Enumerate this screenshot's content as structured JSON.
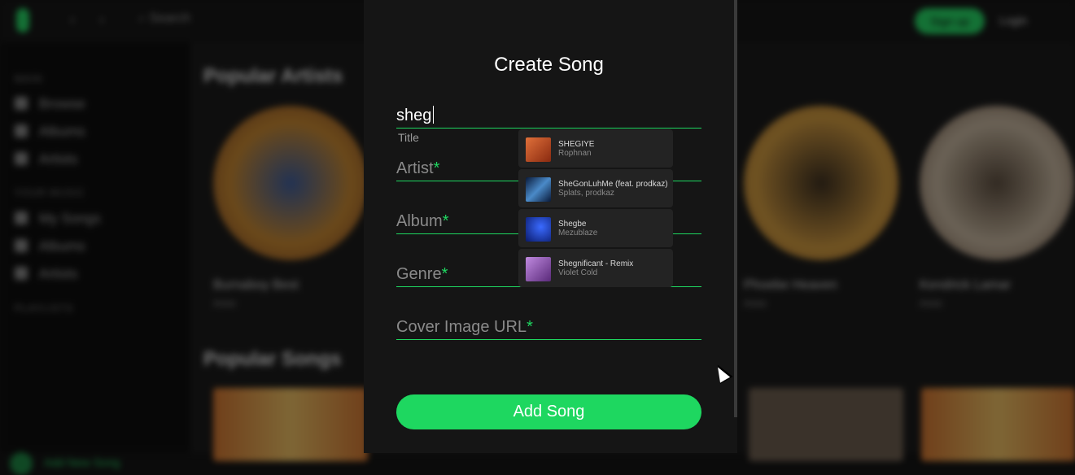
{
  "background": {
    "search_placeholder": "Search",
    "signup_label": "Sign up",
    "login_label": "Login",
    "sidebar": {
      "main_heading": "MAIN",
      "main_items": [
        {
          "label": "Browse",
          "icon": "home-icon"
        },
        {
          "label": "Albums",
          "icon": "album-icon"
        },
        {
          "label": "Artists",
          "icon": "artist-icon"
        }
      ],
      "music_heading": "YOUR MUSIC",
      "music_items": [
        {
          "label": "My Songs",
          "icon": "music-note-icon"
        },
        {
          "label": "Albums",
          "icon": "album-icon"
        },
        {
          "label": "Artists",
          "icon": "artist-icon"
        }
      ],
      "playlists_heading": "PLAYLISTS",
      "add_new_label": "Add New Song"
    },
    "main": {
      "popular_artists_title": "Popular Artists",
      "artists": [
        {
          "name": "Burnaboy Best",
          "sub": "Artist"
        },
        {
          "name": "Phoebe Heaven",
          "sub": "Artist"
        },
        {
          "name": "Kendrick Lamar",
          "sub": "Artist"
        }
      ],
      "popular_songs_title": "Popular Songs"
    }
  },
  "modal": {
    "title": "Create Song",
    "title_field": {
      "value": "sheg",
      "label": "Title"
    },
    "fields": [
      {
        "label": "Artist",
        "required_mark": "*"
      },
      {
        "label": "Album",
        "required_mark": "*"
      },
      {
        "label": "Genre",
        "required_mark": "*"
      },
      {
        "label": "Cover Image URL",
        "required_mark": "*"
      }
    ],
    "submit_label": "Add Song",
    "suggestions": [
      {
        "title": "SHEGIYE",
        "artist": "Rophnan",
        "thumb_color": "#c0562a"
      },
      {
        "title": "SheGonLuhMe (feat. prodkaz)",
        "artist": "Splats, prodkaz",
        "thumb_color": "#2a5a8a"
      },
      {
        "title": "Shegbe",
        "artist": "Mezublaze",
        "thumb_color": "#1a3ea8"
      },
      {
        "title": "Shegnificant - Remix",
        "artist": "Violet Cold",
        "thumb_color": "#9a5ab8"
      }
    ]
  },
  "colors": {
    "accent": "#1ed760",
    "modal_bg": "#151515",
    "suggestion_bg": "#232323"
  }
}
